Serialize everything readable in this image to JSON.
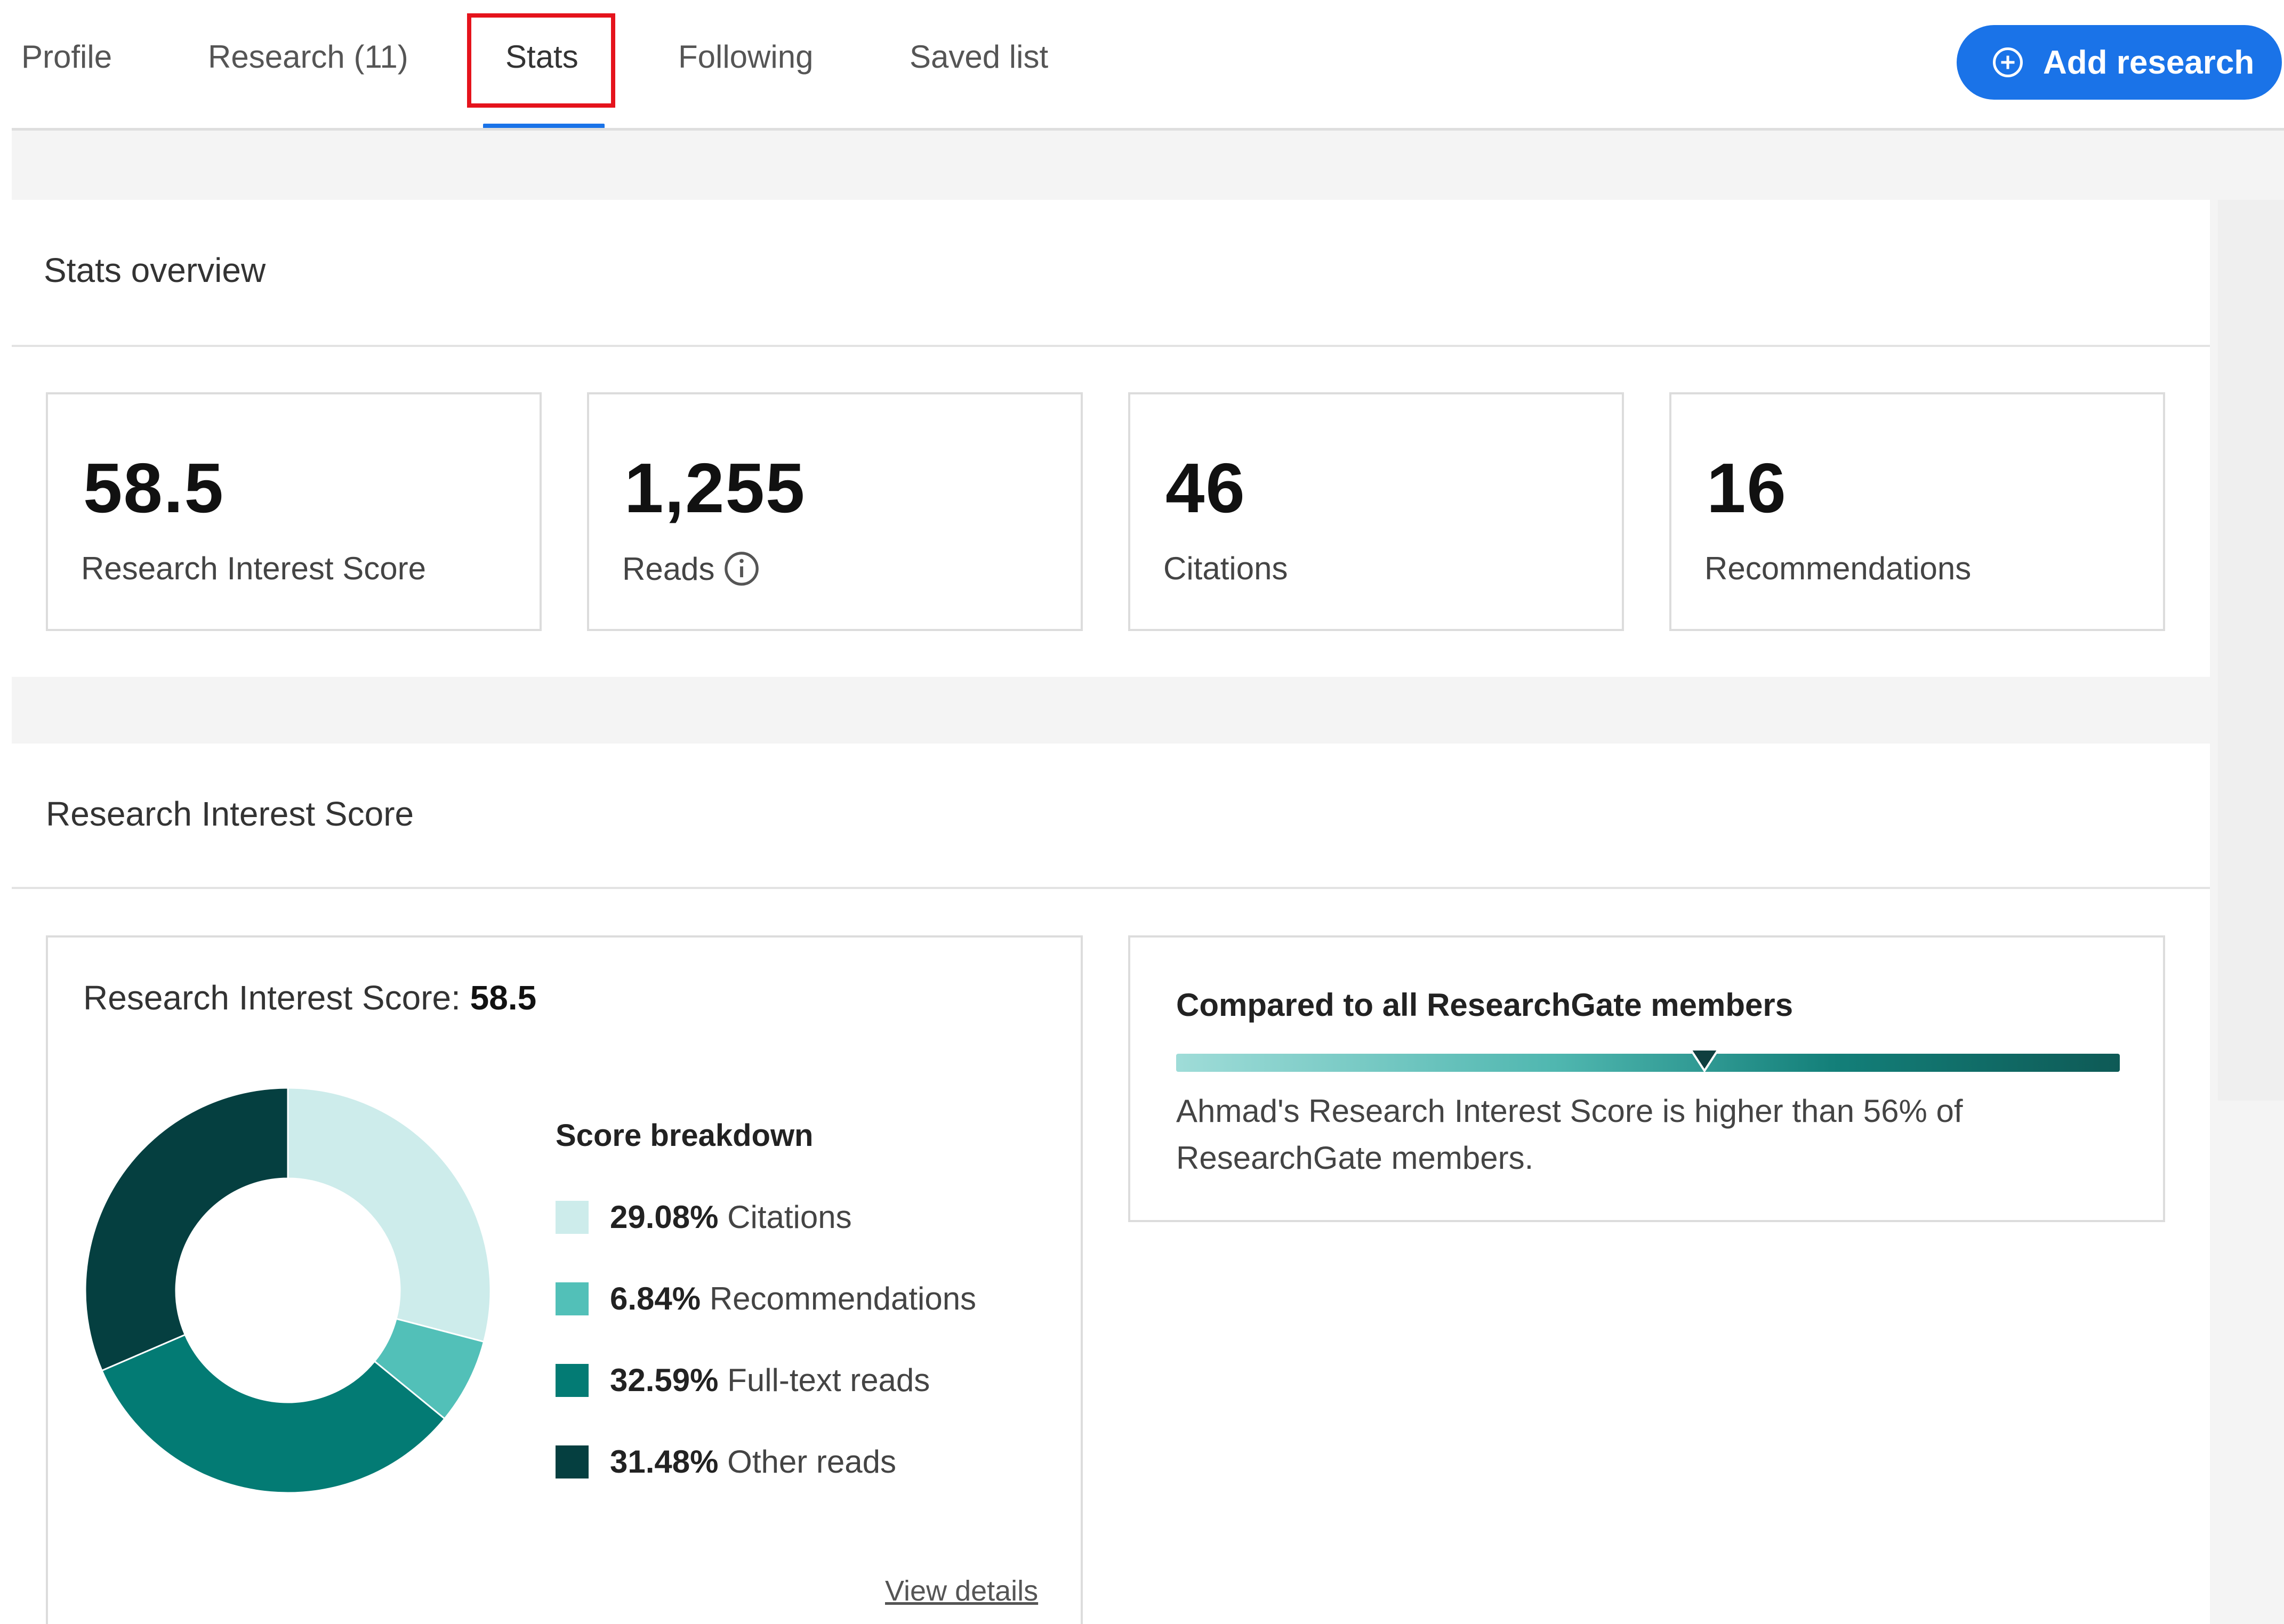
{
  "nav": {
    "tabs": [
      {
        "label": "Profile"
      },
      {
        "label": "Research (11)"
      },
      {
        "label": "Stats"
      },
      {
        "label": "Following"
      },
      {
        "label": "Saved list"
      }
    ],
    "active_tab": "Stats",
    "add_button_label": "Add research",
    "add_button_icon": "plus-circle-icon",
    "accent_color": "#1a73e8",
    "highlight_color": "#e5131c"
  },
  "stats_overview": {
    "title": "Stats overview",
    "cards": [
      {
        "value": "58.5",
        "label": "Research Interest Score"
      },
      {
        "value": "1,255",
        "label": "Reads",
        "icon": "info-icon"
      },
      {
        "value": "46",
        "label": "Citations"
      },
      {
        "value": "16",
        "label": "Recommendations"
      }
    ]
  },
  "research_interest": {
    "section_title": "Research Interest Score",
    "heading_label": "Research Interest Score:",
    "heading_value": "58.5",
    "breakdown_title": "Score breakdown",
    "breakdown": [
      {
        "percent": "29.08%",
        "value": 29.08,
        "label": "Citations",
        "color": "#cdeceb"
      },
      {
        "percent": "6.84%",
        "value": 6.84,
        "label": "Recommendations",
        "color": "#52c0b8"
      },
      {
        "percent": "32.59%",
        "value": 32.59,
        "label": "Full-text reads",
        "color": "#037b74"
      },
      {
        "percent": "31.48%",
        "value": 31.48,
        "label": "Other reads",
        "color": "#053f40"
      }
    ],
    "view_details": "View details"
  },
  "comparison": {
    "title": "Compared to all ResearchGate members",
    "percentile": 56,
    "text": "Ahmad's Research Interest Score is higher than 56% of ResearchGate members."
  }
}
